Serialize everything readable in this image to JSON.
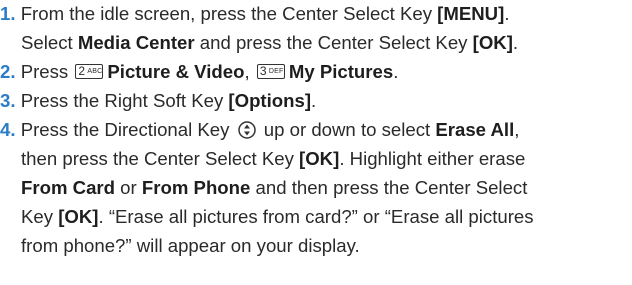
{
  "accent_color": "#2a7dc6",
  "steps": [
    {
      "num": "1.",
      "l1a": "From the idle screen, press the Center Select Key ",
      "l1b": "[MENU]",
      "l1c": ".",
      "l2a": "Select ",
      "l2b": "Media Center",
      "l2c": " and press the Center Select Key ",
      "l2d": "[OK]",
      "l2e": "."
    },
    {
      "num": "2.",
      "a": "Press ",
      "key1": {
        "digit": "2",
        "letters": "ABC"
      },
      "b": "Picture & Video",
      "c": ", ",
      "key2": {
        "digit": "3",
        "letters": "DEF"
      },
      "d": "My Pictures",
      "e": "."
    },
    {
      "num": "3.",
      "a": "Press the Right Soft Key ",
      "b": "[Options]",
      "c": "."
    },
    {
      "num": "4.",
      "l1a": "Press the Directional Key ",
      "l1b": " up or down to select ",
      "l1c": "Erase All",
      "l1d": ",",
      "l2a": "then press the Center Select Key ",
      "l2b": "[OK]",
      "l2c": ". Highlight either erase",
      "l3a": "From Card",
      "l3b": " or ",
      "l3c": "From Phone",
      "l3d": " and then press the Center Select",
      "l4a": "Key ",
      "l4b": "[OK]",
      "l4c": ". “Erase all pictures from card?” or “Erase all pictures",
      "l5": "from phone?” will appear on your display."
    }
  ]
}
